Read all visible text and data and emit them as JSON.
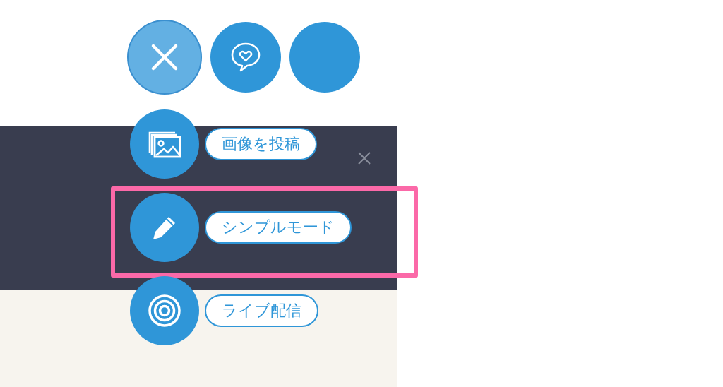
{
  "top_buttons": [
    {
      "kind": "close"
    },
    {
      "kind": "chat"
    },
    {
      "kind": "blank"
    }
  ],
  "panel": {
    "close_button": true
  },
  "menu_items": [
    {
      "kind": "image",
      "label": "画像を投稿",
      "highlighted": false
    },
    {
      "kind": "pencil",
      "label": "シンプルモード",
      "highlighted": true
    },
    {
      "kind": "live",
      "label": "ライブ配信",
      "highlighted": false
    }
  ]
}
